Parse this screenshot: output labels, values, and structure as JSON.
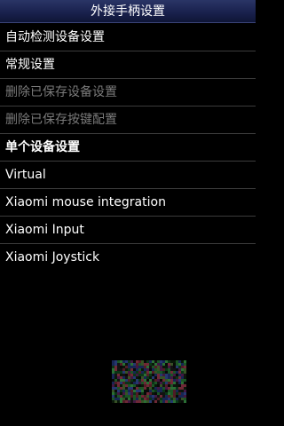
{
  "header": {
    "title": "外接手柄设置"
  },
  "menu": {
    "items": [
      {
        "label": "自动检测设备设置",
        "state": "enabled"
      },
      {
        "label": "常规设置",
        "state": "enabled"
      },
      {
        "label": "删除已保存设备设置",
        "state": "disabled"
      },
      {
        "label": "删除已保存按键配置",
        "state": "disabled"
      },
      {
        "label": "单个设备设置",
        "state": "section-header"
      },
      {
        "label": "Virtual",
        "state": "enabled"
      },
      {
        "label": "Xiaomi mouse integration",
        "state": "enabled"
      },
      {
        "label": "Xiaomi Input",
        "state": "enabled"
      },
      {
        "label": "Xiaomi Joystick",
        "state": "enabled"
      }
    ]
  },
  "colors": {
    "background": "#000000",
    "titlebar": "#1b2350",
    "text": "#ffffff",
    "disabled_text": "#7a7a7a",
    "divider": "#3c3c3c"
  }
}
